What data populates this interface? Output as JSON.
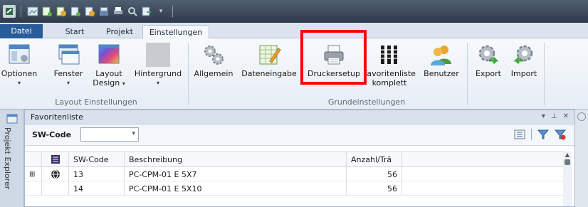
{
  "title_right": "SW-Code",
  "tabs": {
    "datei": "Datei",
    "start": "Start",
    "projekt": "Projekt",
    "einstellungen": "Einstellungen"
  },
  "ribbon": {
    "optionen": "Optionen",
    "fenster": "Fenster",
    "layout_design_1": "Layout",
    "layout_design_2": "Design",
    "hintergrund": "Hintergrund",
    "allgemein": "Allgemein",
    "dateneingabe": "Dateneingabe",
    "druckersetup": "Druckersetup",
    "favoritenliste_1": "Favoritenliste",
    "favoritenliste_2": "komplett",
    "benutzer": "Benutzer",
    "export": "Export",
    "import": "Import",
    "group_layout": "Layout Einstellungen",
    "group_grund": "Grundeinstellungen"
  },
  "sidebar": {
    "label": "Projekt Explorer"
  },
  "panel": {
    "title": "Favoritenliste",
    "sw_label": "SW-Code",
    "sw_value": ""
  },
  "grid": {
    "headers": [
      "SW-Code",
      "Beschreibung",
      "Anzahl/Trä"
    ],
    "rows": [
      {
        "code": "13",
        "desc": "PC-CPM-01 E 5X7",
        "count": "56"
      },
      {
        "code": "14",
        "desc": "PC-CPM-01 E 5X10",
        "count": "56"
      }
    ]
  },
  "colors": {
    "accent": "#2a5c9a",
    "highlight": "#ff0000"
  }
}
